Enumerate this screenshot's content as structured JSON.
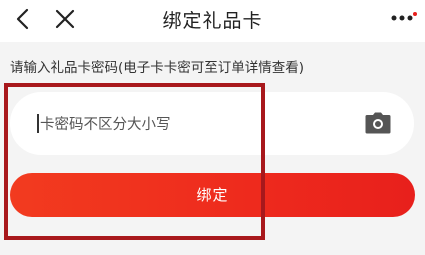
{
  "header": {
    "title": "绑定礼品卡"
  },
  "form": {
    "hint": "请输入礼品卡密码(电子卡卡密可至订单详情查看)",
    "input_value": "卡密码不区分大小写",
    "submit_label": "绑定"
  },
  "icons": {
    "back": "chevron-left-icon",
    "close": "close-icon",
    "more": "more-dots-icon",
    "camera": "camera-icon"
  },
  "colors": {
    "accent": "#ee2a1d",
    "annotation": "#a8181c"
  }
}
